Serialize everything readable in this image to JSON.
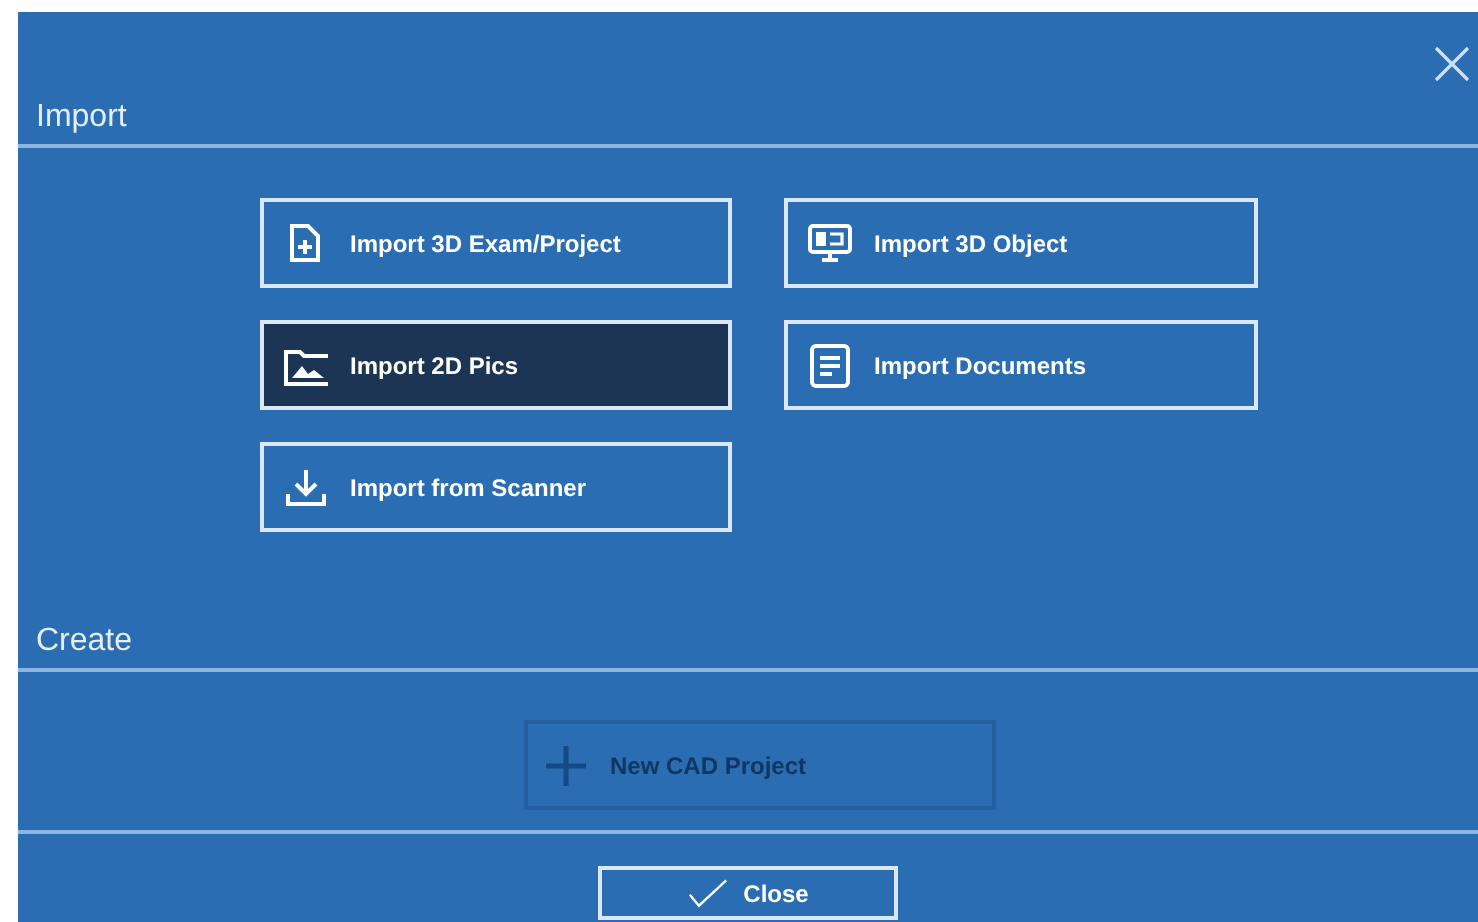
{
  "sections": [
    {
      "title": "Import",
      "buttons": [
        {
          "label": "Import 3D Exam/Project",
          "kind": "file-plus",
          "selected": false,
          "disabled": false
        },
        {
          "label": "Import 3D Object",
          "kind": "monitor",
          "selected": false,
          "disabled": false
        },
        {
          "label": "Import 2D Pics",
          "kind": "image-folder",
          "selected": true,
          "disabled": false
        },
        {
          "label": "Import Documents",
          "kind": "document",
          "selected": false,
          "disabled": false
        },
        {
          "label": "Import from Scanner",
          "kind": "download",
          "selected": false,
          "disabled": false
        }
      ]
    },
    {
      "title": "Create",
      "buttons": [
        {
          "label": "New CAD Project",
          "kind": "plus",
          "selected": false,
          "disabled": true
        }
      ]
    }
  ],
  "close_button": {
    "label": "Close"
  }
}
